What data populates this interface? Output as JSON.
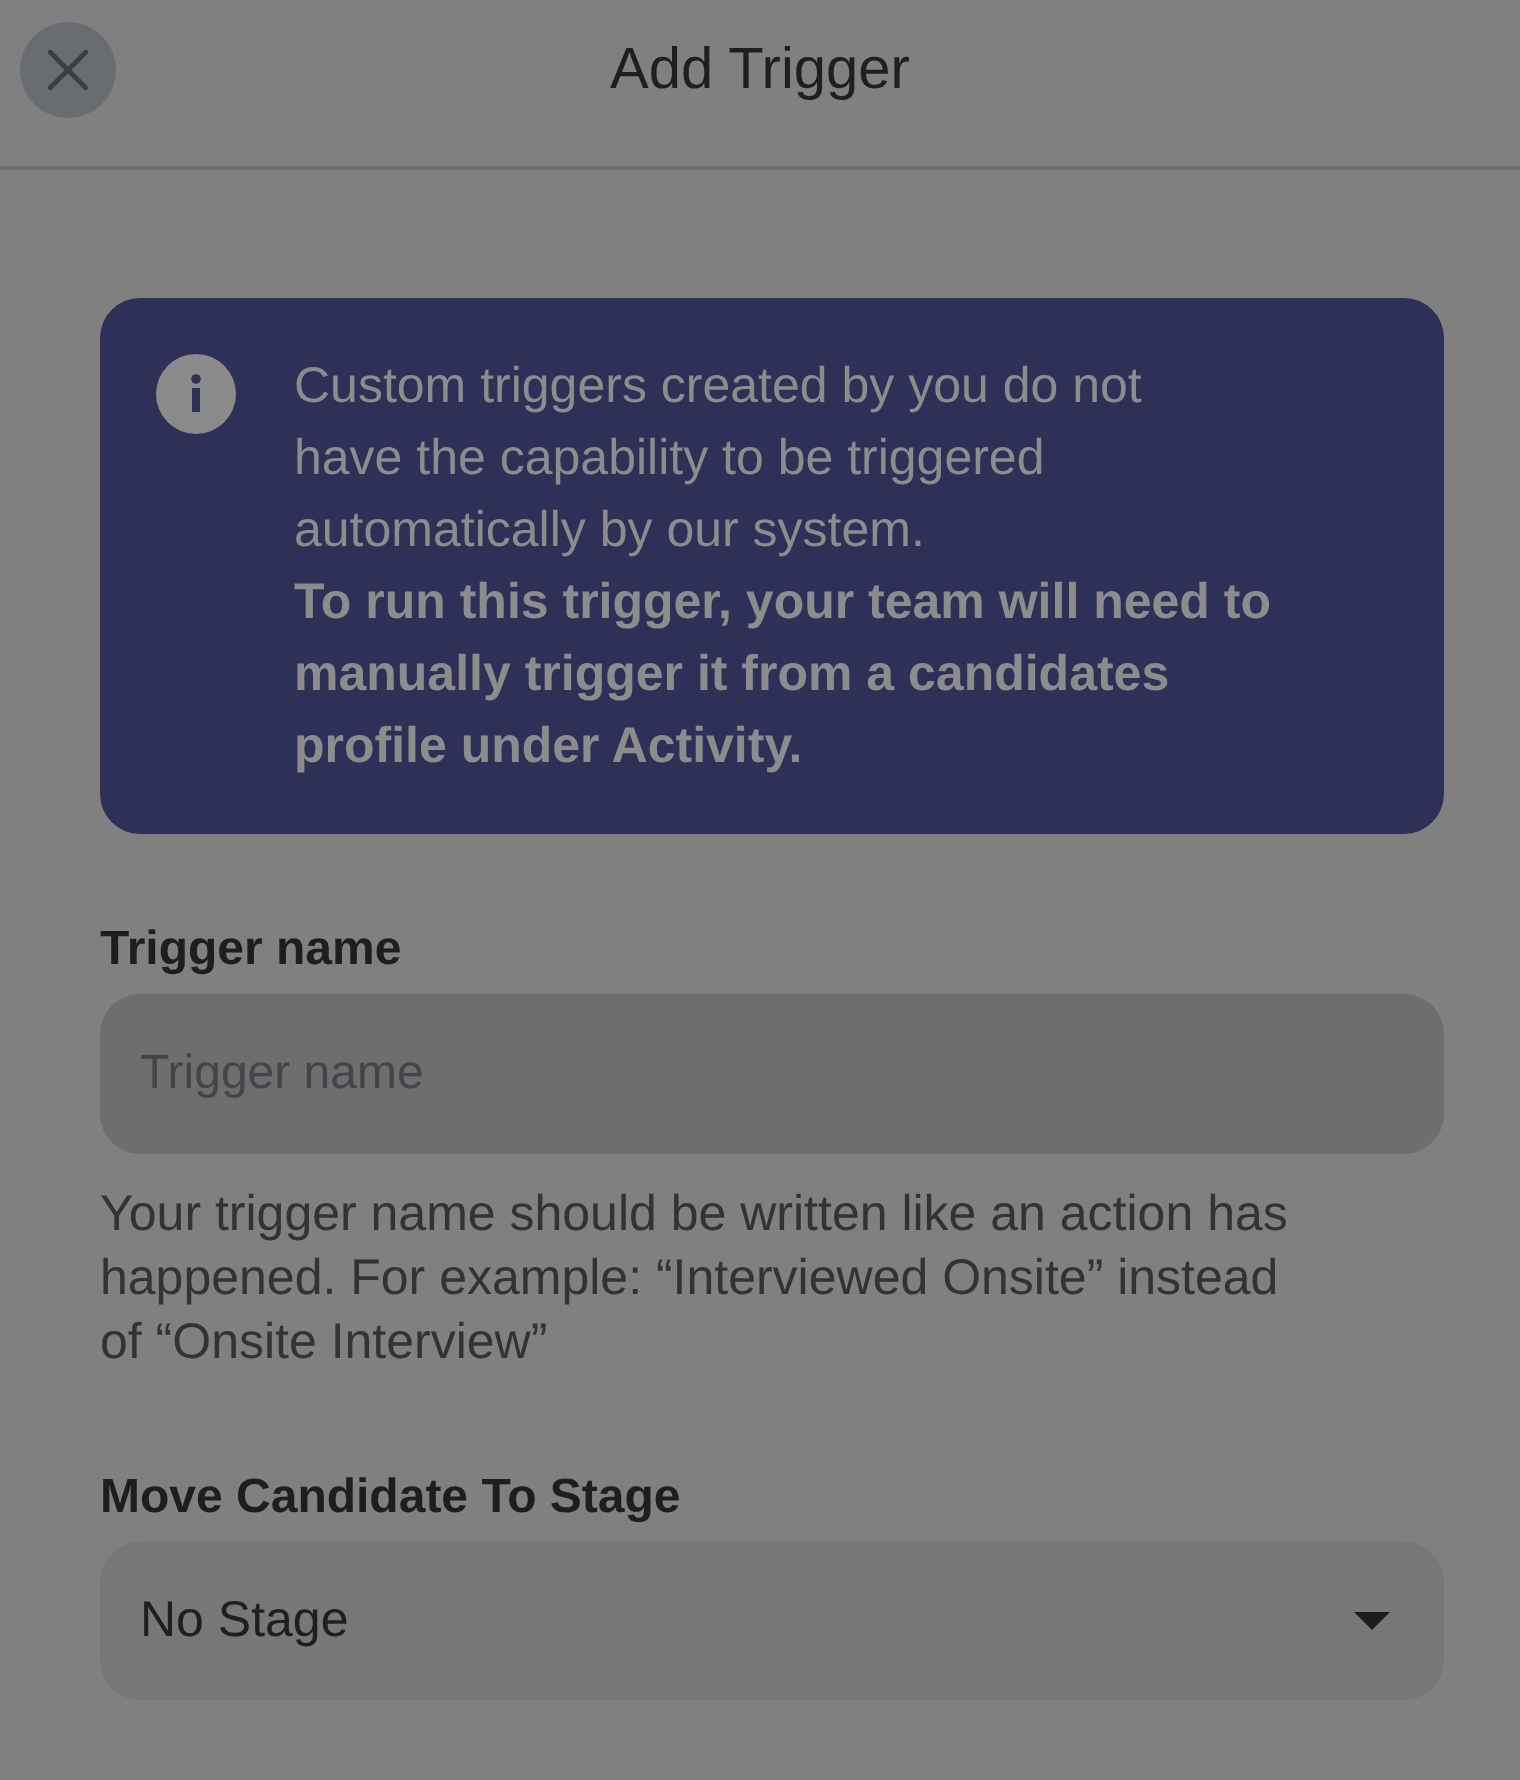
{
  "header": {
    "title": "Add Trigger"
  },
  "info_banner": {
    "message": "Custom triggers created by you do not have the capability to be triggered automatically by our system.",
    "emphasis": "To run this trigger, your team will need to manually trigger it from a candidates profile under Activity."
  },
  "fields": [
    {
      "kind": "text",
      "label": "Trigger name",
      "placeholder": "Trigger name",
      "help": "Your trigger name should be written like an action has happened. For example: “Interviewed Onsite” instead of “Onsite Interview”"
    },
    {
      "kind": "select",
      "label": "Move Candidate To Stage",
      "value": "No Stage"
    }
  ]
}
